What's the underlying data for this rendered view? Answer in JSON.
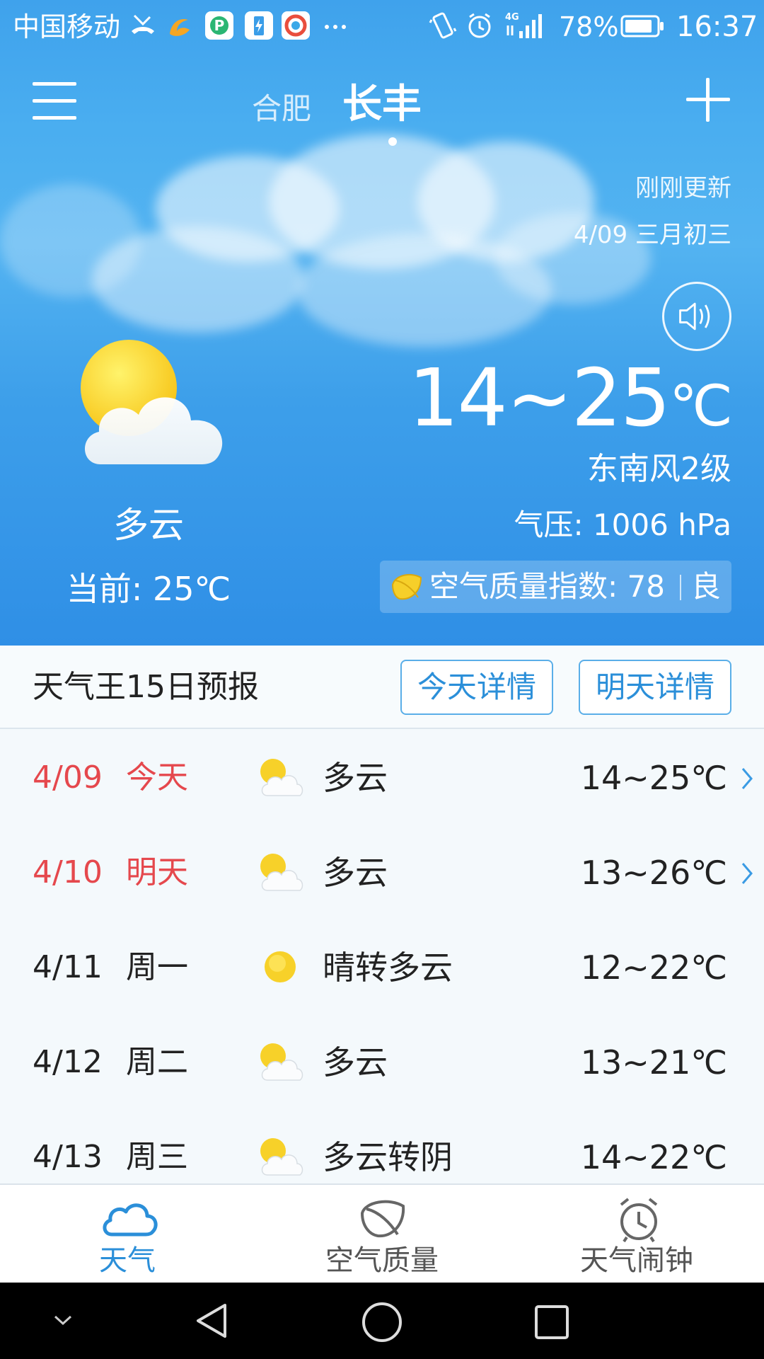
{
  "status_bar": {
    "carrier": "中国移动",
    "battery_percent": "78%",
    "time": "16:37",
    "network": "4G"
  },
  "header": {
    "city_prev": "合肥",
    "city_current": "长丰"
  },
  "current": {
    "update_status": "刚刚更新",
    "date_lunar": "4/09 三月初三",
    "condition": "多云",
    "current_temp": "当前: 25℃",
    "temp_range": "14~25",
    "temp_unit": "℃",
    "wind": "东南风2级",
    "pressure": "气压: 1006 hPa",
    "aqi_label": "空气质量指数: 78",
    "aqi_level": "良"
  },
  "forecast": {
    "title": "天气王15日预报",
    "today_detail": "今天详情",
    "tomorrow_detail": "明天详情",
    "days": [
      {
        "date": "4/09",
        "name": "今天",
        "icon": "partly-cloudy-icon",
        "condition": "多云",
        "temp": "14~25℃"
      },
      {
        "date": "4/10",
        "name": "明天",
        "icon": "partly-cloudy-icon",
        "condition": "多云",
        "temp": "13~26℃"
      },
      {
        "date": "4/11",
        "name": "周一",
        "icon": "sun-icon",
        "condition": "晴转多云",
        "temp": "12~22℃"
      },
      {
        "date": "4/12",
        "name": "周二",
        "icon": "partly-cloudy-icon",
        "condition": "多云",
        "temp": "13~21℃"
      },
      {
        "date": "4/13",
        "name": "周三",
        "icon": "partly-cloudy-icon",
        "condition": "多云转阴",
        "temp": "14~22℃"
      }
    ]
  },
  "bottom_nav": {
    "weather": "天气",
    "air_quality": "空气质量",
    "alarm": "天气闹钟"
  },
  "colors": {
    "accent": "#2b8fd9",
    "highlight_day": "#e5484d",
    "sky_top": "#3fa2ec",
    "sky_bottom": "#2f8fe6"
  }
}
